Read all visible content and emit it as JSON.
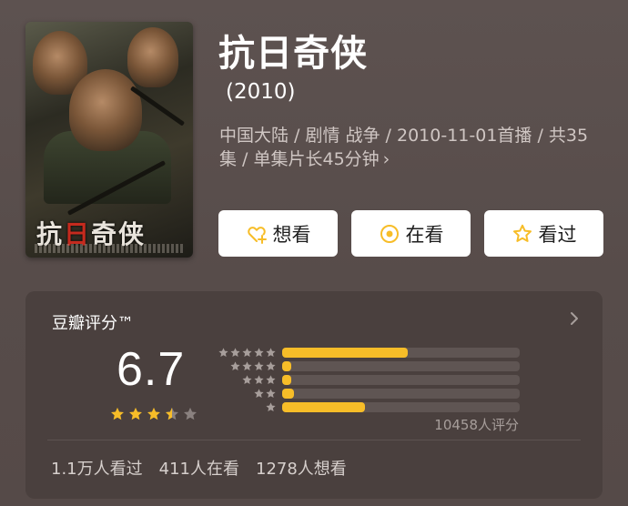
{
  "movie": {
    "title": "抗日奇侠",
    "year": "(2010)",
    "meta": "中国大陆 / 剧情 战争 / 2010-11-01首播 / 共35集 / 单集片长45分钟",
    "meta_chevron": "›",
    "poster_title_a": "抗",
    "poster_title_b": "日",
    "poster_title_c": "奇侠"
  },
  "actions": {
    "want_label": "想看",
    "doing_label": "在看",
    "done_label": "看过"
  },
  "rating": {
    "heading": "豆瓣评分™",
    "score": "6.7",
    "stars_filled": 3.5,
    "stars_total": 5,
    "distribution": [
      {
        "stars": 5,
        "percent": 53
      },
      {
        "stars": 4,
        "percent": 4
      },
      {
        "stars": 3,
        "percent": 4
      },
      {
        "stars": 2,
        "percent": 5
      },
      {
        "stars": 1,
        "percent": 35
      }
    ],
    "count_text": "10458人评分"
  },
  "stats": {
    "watched": "1.1万人看过",
    "watching": "411人在看",
    "want": "1278人想看"
  },
  "colors": {
    "accent": "#f7bd28",
    "background": "#5a4f4d",
    "card": "#4a403e"
  }
}
